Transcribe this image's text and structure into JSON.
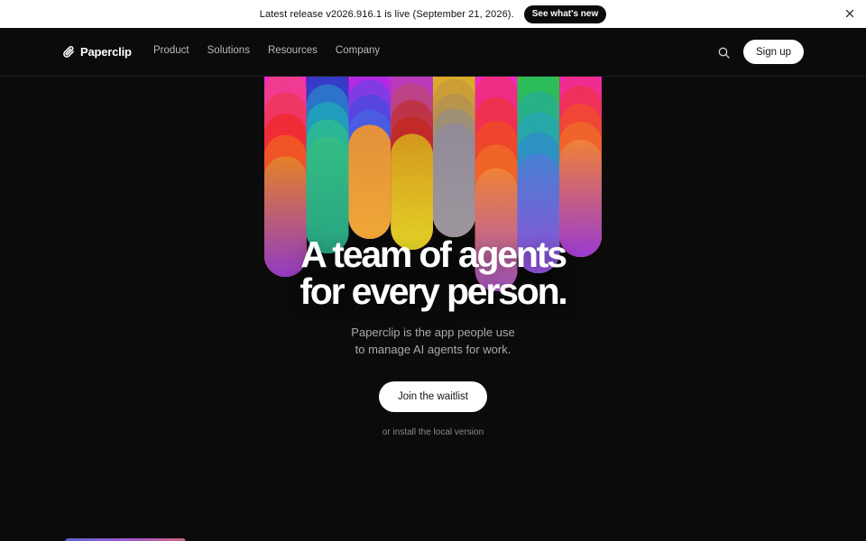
{
  "announcement": {
    "text": "Latest release v2026.916.1 is live (September 21, 2026).",
    "button_label": "See what's new"
  },
  "nav": {
    "brand": "Paperclip",
    "links": [
      "Product",
      "Solutions",
      "Resources",
      "Company"
    ],
    "signup_label": "Sign up"
  },
  "hero": {
    "headline_line1": "A team of agents",
    "headline_line2": "for every person.",
    "sub_line1": "Paperclip is the app people use",
    "sub_line2": "to manage AI agents for work.",
    "cta_label": "Join the waitlist",
    "install_text": "or install the local version"
  },
  "colors": {
    "background": "#0b0b0c",
    "announcement_bg": "#ffffff",
    "button_bg": "#ffffff"
  },
  "icons": {
    "brand": "paperclip-icon",
    "search": "search-icon",
    "close": "close-icon"
  }
}
